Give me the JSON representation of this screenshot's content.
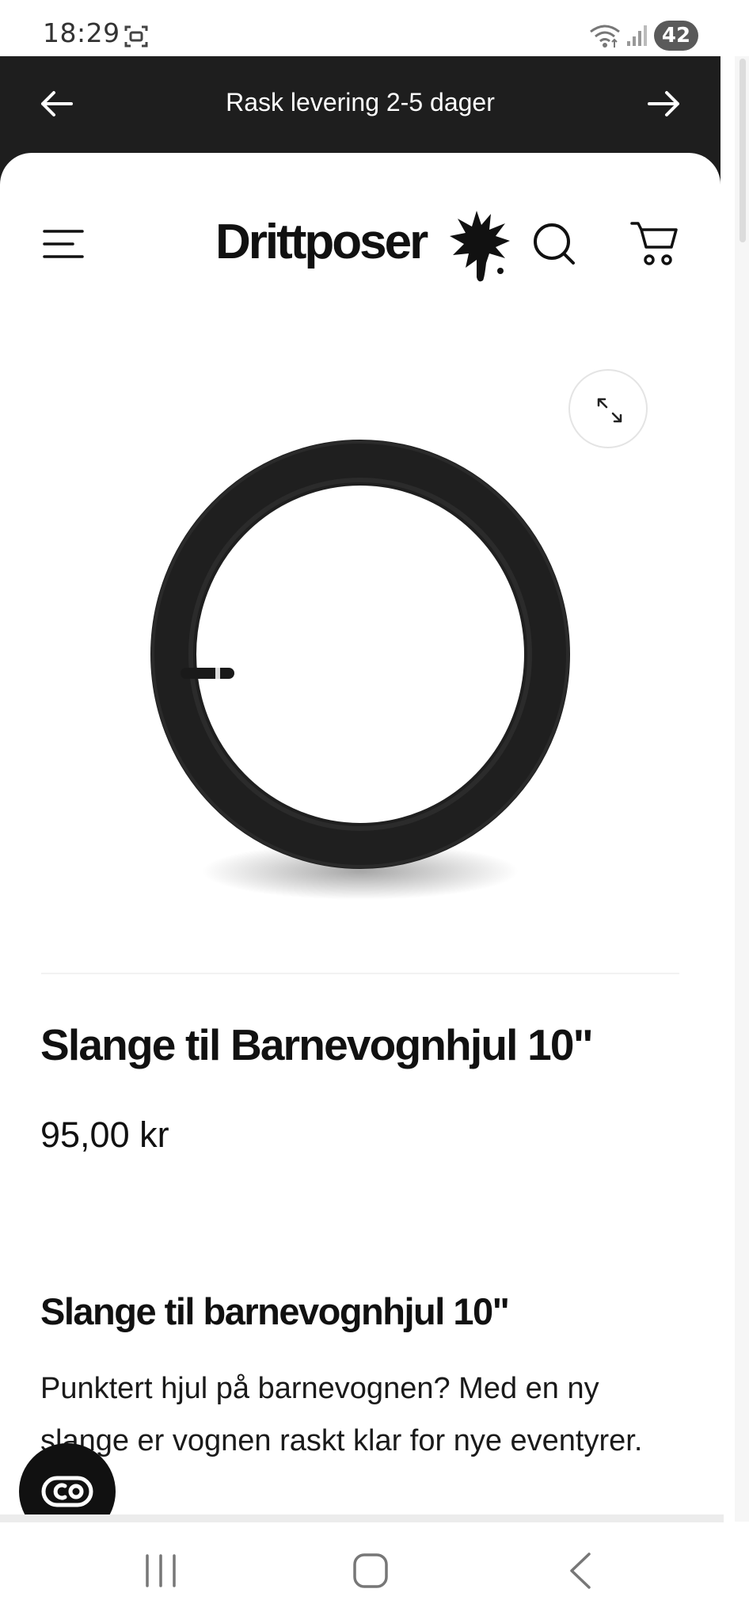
{
  "status_bar": {
    "time": "18:29",
    "battery": "42",
    "icons": [
      "screenshot-icon",
      "wifi-icon",
      "signal-icon"
    ]
  },
  "announcement": {
    "text": "Rask levering 2-5 dager",
    "prev_icon": "arrow-left-icon",
    "next_icon": "arrow-right-icon"
  },
  "header": {
    "logo_text": "Drittposer",
    "menu_icon": "hamburger-menu-icon",
    "search_icon": "search-icon",
    "cart_icon": "cart-icon"
  },
  "product": {
    "title": "Slange til Barnevognhjul 10\"",
    "price": "95,00 kr",
    "zoom_icon": "expand-icon",
    "image_alt": "inner-tube-icon"
  },
  "description": {
    "heading": "Slange til barnevognhjul 10\"",
    "body": "Punktert hjul på barnevognen? Med en ny slange er vognen raskt klar for nye eventyrer."
  },
  "chat": {
    "icon": "chat-widget-icon"
  },
  "nav_bar": {
    "recent": "recent-apps-icon",
    "home": "home-icon",
    "back": "back-icon"
  },
  "colors": {
    "announcement_bg": "#1e1e1e",
    "text": "#111111",
    "background": "#ffffff"
  }
}
